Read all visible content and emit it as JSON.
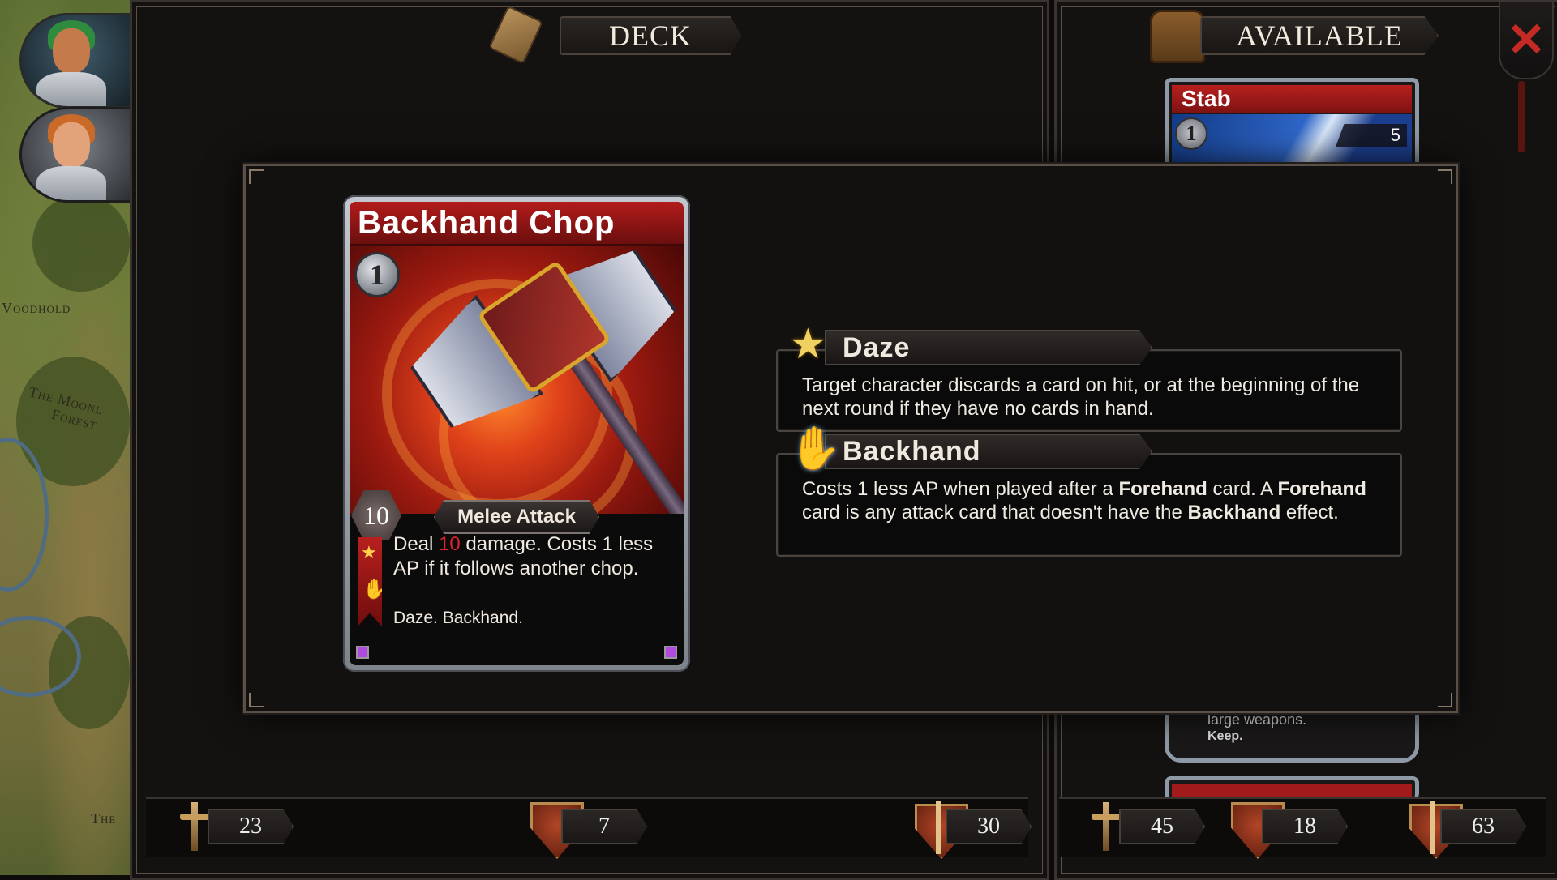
{
  "map": {
    "places": [
      "Voodhold",
      "The Moonl",
      "Forest",
      "The"
    ]
  },
  "deck_header": {
    "title": "DECK"
  },
  "available_header": {
    "title": "AVAILABLE"
  },
  "close": {
    "label": "✕"
  },
  "available_cards": [
    {
      "title": "Stab",
      "cost": "1",
      "value": "5"
    },
    {
      "text_line1": "large weapons.",
      "text_line2": "Keep."
    }
  ],
  "deck_stats": [
    {
      "icon": "sword-icon",
      "value": "23"
    },
    {
      "icon": "shield-icon",
      "value": "7"
    },
    {
      "icon": "shield-sword-icon",
      "value": "30"
    }
  ],
  "available_stats": [
    {
      "icon": "sword-icon",
      "value": "45"
    },
    {
      "icon": "shield-icon",
      "value": "18"
    },
    {
      "icon": "shield-sword-icon",
      "value": "63"
    }
  ],
  "card": {
    "title": "Backhand Chop",
    "cost": "1",
    "damage": "10",
    "type": "Melee Attack",
    "text_pre": "Deal ",
    "text_num": "10",
    "text_post": " damage. Costs 1 less AP if it follows another chop.",
    "keywords": "Daze. Backhand."
  },
  "keywords": [
    {
      "name": "Daze",
      "icon": "star-icon",
      "desc": "Target character discards a card on hit, or at the beginning of the next round if they have no cards in hand."
    },
    {
      "name": "Backhand",
      "icon": "hand-icon",
      "desc_parts": [
        "Costs 1 less AP when played after a ",
        "Forehand",
        " card. A ",
        "Forehand",
        " card is any attack card that doesn't have the ",
        "Backhand",
        " effect."
      ]
    }
  ],
  "colors": {
    "accent_red": "#b31c1b",
    "damage_number": "#e3232b",
    "frame": "#5a5048"
  }
}
